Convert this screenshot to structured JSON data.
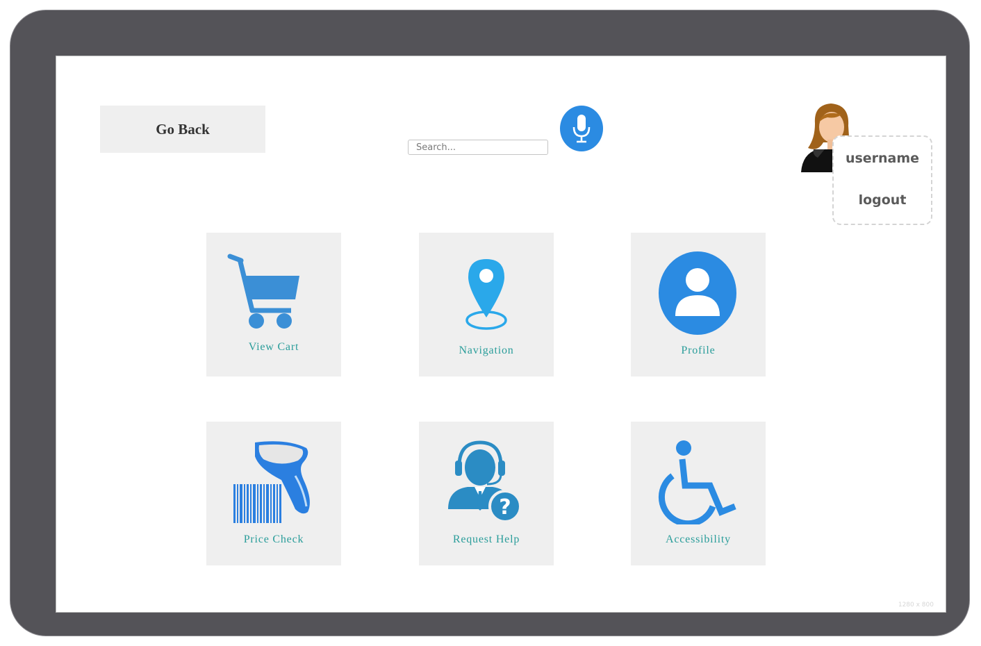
{
  "nav": {
    "go_back_label": "Go Back"
  },
  "search": {
    "placeholder": "Search..."
  },
  "user_menu": {
    "username": "username",
    "logout": "logout"
  },
  "tiles": [
    {
      "label": "View Cart",
      "icon": "cart-icon"
    },
    {
      "label": "Navigation",
      "icon": "map-pin-icon"
    },
    {
      "label": "Profile",
      "icon": "profile-icon"
    },
    {
      "label": "Price Check",
      "icon": "barcode-scanner-icon"
    },
    {
      "label": "Request Help",
      "icon": "support-agent-icon"
    },
    {
      "label": "Accessibility",
      "icon": "wheelchair-icon"
    }
  ],
  "frame": {
    "resolution_label": "1280 x 800"
  },
  "colors": {
    "accent": "#2b8be2",
    "tile_label": "#2a9d9a",
    "tile_bg": "#efefef",
    "device_frame": "#545358"
  }
}
